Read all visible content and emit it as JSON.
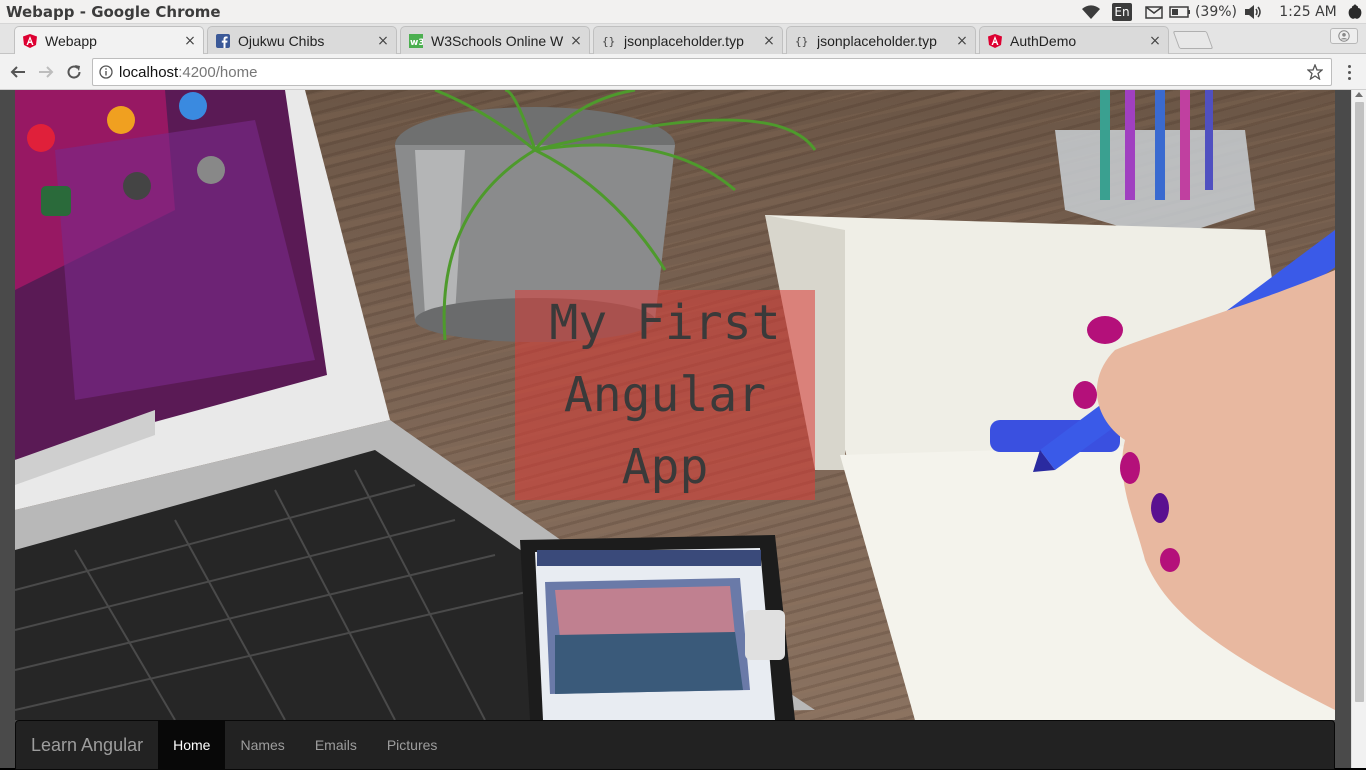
{
  "os": {
    "window_title": "Webapp - Google Chrome",
    "tray": {
      "wifi_icon": "wifi-icon",
      "language": "En",
      "mail_icon": "mail-icon",
      "battery_text": "(39%)",
      "volume_icon": "volume-icon",
      "clock": "1:25 AM",
      "settings_icon": "power-gear-icon"
    }
  },
  "browser": {
    "tabs": [
      {
        "title": "Webapp",
        "icon": "angular-icon",
        "active": true
      },
      {
        "title": "Ojukwu Chibs",
        "icon": "facebook-icon",
        "active": false
      },
      {
        "title": "W3Schools Online W",
        "icon": "w3schools-icon",
        "active": false
      },
      {
        "title": "jsonplaceholder.typ",
        "icon": "json-icon",
        "active": false
      },
      {
        "title": "jsonplaceholder.typ",
        "icon": "json-icon",
        "active": false
      },
      {
        "title": "AuthDemo",
        "icon": "angular-icon",
        "active": false
      }
    ],
    "tab_close": "×",
    "url": {
      "host": "localhost",
      "path": ":4200/home"
    }
  },
  "page": {
    "hero_title": "My First Angular App",
    "navbar": {
      "brand": "Learn Angular",
      "links": [
        {
          "label": "Home",
          "active": true
        },
        {
          "label": "Names",
          "active": false
        },
        {
          "label": "Emails",
          "active": false
        },
        {
          "label": "Pictures",
          "active": false
        }
      ]
    }
  }
}
